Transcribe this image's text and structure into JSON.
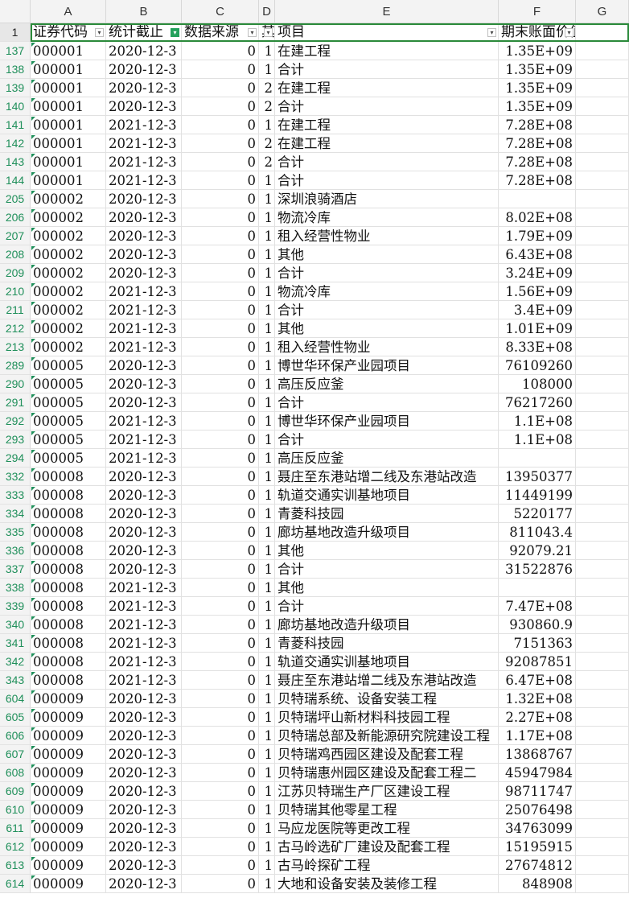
{
  "columns": [
    "A",
    "B",
    "C",
    "D",
    "E",
    "F",
    "G"
  ],
  "header_row_number": "1",
  "headers": {
    "A": "证券代码",
    "B": "统计截止",
    "C": "数据来源",
    "D": "其",
    "E": "项目",
    "F": "期末账面价值"
  },
  "rows": [
    {
      "n": "137",
      "a": "000001",
      "b": "2020-12-3",
      "c": "0",
      "d": "1",
      "e": "在建工程",
      "f": "1.35E+09"
    },
    {
      "n": "138",
      "a": "000001",
      "b": "2020-12-3",
      "c": "0",
      "d": "1",
      "e": "合计",
      "f": "1.35E+09"
    },
    {
      "n": "139",
      "a": "000001",
      "b": "2020-12-3",
      "c": "0",
      "d": "2",
      "e": "在建工程",
      "f": "1.35E+09"
    },
    {
      "n": "140",
      "a": "000001",
      "b": "2020-12-3",
      "c": "0",
      "d": "2",
      "e": "合计",
      "f": "1.35E+09"
    },
    {
      "n": "141",
      "a": "000001",
      "b": "2021-12-3",
      "c": "0",
      "d": "1",
      "e": "在建工程",
      "f": "7.28E+08"
    },
    {
      "n": "142",
      "a": "000001",
      "b": "2021-12-3",
      "c": "0",
      "d": "2",
      "e": "在建工程",
      "f": "7.28E+08"
    },
    {
      "n": "143",
      "a": "000001",
      "b": "2021-12-3",
      "c": "0",
      "d": "2",
      "e": "合计",
      "f": "7.28E+08"
    },
    {
      "n": "144",
      "a": "000001",
      "b": "2021-12-3",
      "c": "0",
      "d": "1",
      "e": "合计",
      "f": "7.28E+08"
    },
    {
      "n": "205",
      "a": "000002",
      "b": "2020-12-3",
      "c": "0",
      "d": "1",
      "e": "深圳浪骑酒店",
      "f": ""
    },
    {
      "n": "206",
      "a": "000002",
      "b": "2020-12-3",
      "c": "0",
      "d": "1",
      "e": "物流冷库",
      "f": "8.02E+08"
    },
    {
      "n": "207",
      "a": "000002",
      "b": "2020-12-3",
      "c": "0",
      "d": "1",
      "e": "租入经营性物业",
      "f": "1.79E+09"
    },
    {
      "n": "208",
      "a": "000002",
      "b": "2020-12-3",
      "c": "0",
      "d": "1",
      "e": "其他",
      "f": "6.43E+08"
    },
    {
      "n": "209",
      "a": "000002",
      "b": "2020-12-3",
      "c": "0",
      "d": "1",
      "e": "合计",
      "f": "3.24E+09"
    },
    {
      "n": "210",
      "a": "000002",
      "b": "2021-12-3",
      "c": "0",
      "d": "1",
      "e": "物流冷库",
      "f": "1.56E+09"
    },
    {
      "n": "211",
      "a": "000002",
      "b": "2021-12-3",
      "c": "0",
      "d": "1",
      "e": "合计",
      "f": "3.4E+09"
    },
    {
      "n": "212",
      "a": "000002",
      "b": "2021-12-3",
      "c": "0",
      "d": "1",
      "e": "其他",
      "f": "1.01E+09"
    },
    {
      "n": "213",
      "a": "000002",
      "b": "2021-12-3",
      "c": "0",
      "d": "1",
      "e": "租入经营性物业",
      "f": "8.33E+08"
    },
    {
      "n": "289",
      "a": "000005",
      "b": "2020-12-3",
      "c": "0",
      "d": "1",
      "e": "博世华环保产业园项目",
      "f": "76109260"
    },
    {
      "n": "290",
      "a": "000005",
      "b": "2020-12-3",
      "c": "0",
      "d": "1",
      "e": "高压反应釜",
      "f": "108000"
    },
    {
      "n": "291",
      "a": "000005",
      "b": "2020-12-3",
      "c": "0",
      "d": "1",
      "e": "合计",
      "f": "76217260"
    },
    {
      "n": "292",
      "a": "000005",
      "b": "2021-12-3",
      "c": "0",
      "d": "1",
      "e": "博世华环保产业园项目",
      "f": "1.1E+08"
    },
    {
      "n": "293",
      "a": "000005",
      "b": "2021-12-3",
      "c": "0",
      "d": "1",
      "e": "合计",
      "f": "1.1E+08"
    },
    {
      "n": "294",
      "a": "000005",
      "b": "2021-12-3",
      "c": "0",
      "d": "1",
      "e": "高压反应釜",
      "f": ""
    },
    {
      "n": "332",
      "a": "000008",
      "b": "2020-12-3",
      "c": "0",
      "d": "1",
      "e": "聂庄至东港站增二线及东港站改造",
      "f": "13950377"
    },
    {
      "n": "333",
      "a": "000008",
      "b": "2020-12-3",
      "c": "0",
      "d": "1",
      "e": "轨道交通实训基地项目",
      "f": "11449199"
    },
    {
      "n": "334",
      "a": "000008",
      "b": "2020-12-3",
      "c": "0",
      "d": "1",
      "e": "青菱科技园",
      "f": "5220177"
    },
    {
      "n": "335",
      "a": "000008",
      "b": "2020-12-3",
      "c": "0",
      "d": "1",
      "e": "廊坊基地改造升级项目",
      "f": "811043.4"
    },
    {
      "n": "336",
      "a": "000008",
      "b": "2020-12-3",
      "c": "0",
      "d": "1",
      "e": "其他",
      "f": "92079.21"
    },
    {
      "n": "337",
      "a": "000008",
      "b": "2020-12-3",
      "c": "0",
      "d": "1",
      "e": "合计",
      "f": "31522876"
    },
    {
      "n": "338",
      "a": "000008",
      "b": "2021-12-3",
      "c": "0",
      "d": "1",
      "e": "其他",
      "f": ""
    },
    {
      "n": "339",
      "a": "000008",
      "b": "2021-12-3",
      "c": "0",
      "d": "1",
      "e": "合计",
      "f": "7.47E+08"
    },
    {
      "n": "340",
      "a": "000008",
      "b": "2021-12-3",
      "c": "0",
      "d": "1",
      "e": "廊坊基地改造升级项目",
      "f": "930860.9"
    },
    {
      "n": "341",
      "a": "000008",
      "b": "2021-12-3",
      "c": "0",
      "d": "1",
      "e": "青菱科技园",
      "f": "7151363"
    },
    {
      "n": "342",
      "a": "000008",
      "b": "2021-12-3",
      "c": "0",
      "d": "1",
      "e": "轨道交通实训基地项目",
      "f": "92087851"
    },
    {
      "n": "343",
      "a": "000008",
      "b": "2021-12-3",
      "c": "0",
      "d": "1",
      "e": "聂庄至东港站增二线及东港站改造",
      "f": "6.47E+08"
    },
    {
      "n": "604",
      "a": "000009",
      "b": "2020-12-3",
      "c": "0",
      "d": "1",
      "e": "贝特瑞系统、设备安装工程",
      "f": "1.32E+08"
    },
    {
      "n": "605",
      "a": "000009",
      "b": "2020-12-3",
      "c": "0",
      "d": "1",
      "e": "贝特瑞坪山新材料科技园工程",
      "f": "2.27E+08"
    },
    {
      "n": "606",
      "a": "000009",
      "b": "2020-12-3",
      "c": "0",
      "d": "1",
      "e": "贝特瑞总部及新能源研究院建设工程",
      "f": "1.17E+08"
    },
    {
      "n": "607",
      "a": "000009",
      "b": "2020-12-3",
      "c": "0",
      "d": "1",
      "e": "贝特瑞鸡西园区建设及配套工程",
      "f": "13868767"
    },
    {
      "n": "608",
      "a": "000009",
      "b": "2020-12-3",
      "c": "0",
      "d": "1",
      "e": "贝特瑞惠州园区建设及配套工程二",
      "f": "45947984"
    },
    {
      "n": "609",
      "a": "000009",
      "b": "2020-12-3",
      "c": "0",
      "d": "1",
      "e": "江苏贝特瑞生产厂区建设工程",
      "f": "98711747"
    },
    {
      "n": "610",
      "a": "000009",
      "b": "2020-12-3",
      "c": "0",
      "d": "1",
      "e": "贝特瑞其他零星工程",
      "f": "25076498"
    },
    {
      "n": "611",
      "a": "000009",
      "b": "2020-12-3",
      "c": "0",
      "d": "1",
      "e": "马应龙医院等更改工程",
      "f": "34763099"
    },
    {
      "n": "612",
      "a": "000009",
      "b": "2020-12-3",
      "c": "0",
      "d": "1",
      "e": "古马岭选矿厂建设及配套工程",
      "f": "15195915"
    },
    {
      "n": "613",
      "a": "000009",
      "b": "2020-12-3",
      "c": "0",
      "d": "1",
      "e": "古马岭探矿工程",
      "f": "27674812"
    },
    {
      "n": "614",
      "a": "000009",
      "b": "2020-12-3",
      "c": "0",
      "d": "1",
      "e": "大地和设备安装及装修工程",
      "f": "848908"
    }
  ]
}
